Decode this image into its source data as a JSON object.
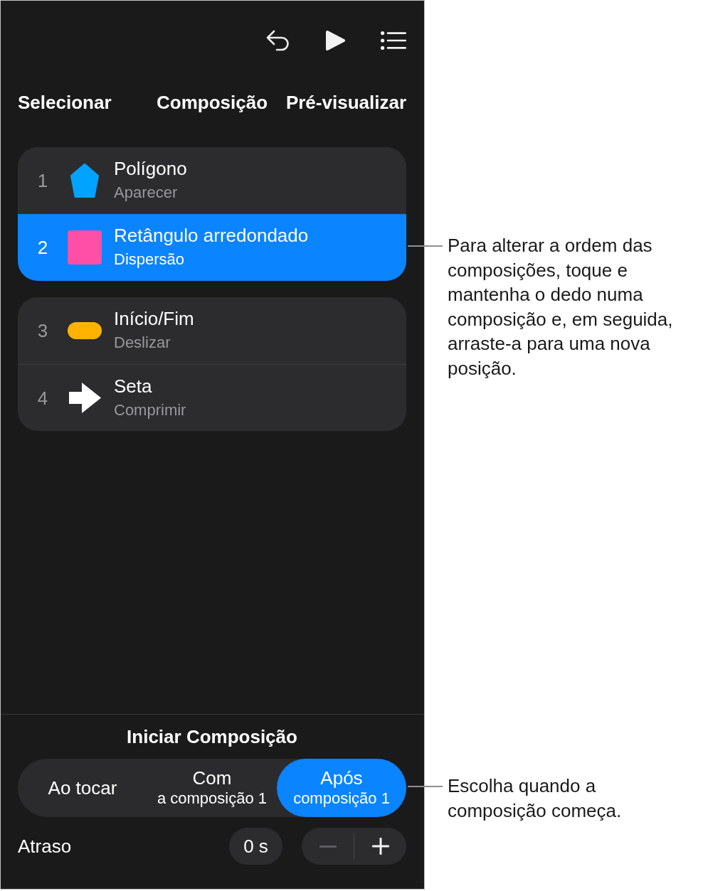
{
  "nav_bar": {
    "left_button": "Selecionar",
    "title": "Composição",
    "right_button": "Pré-visualizar"
  },
  "build_list": {
    "groups": [
      {
        "rows": [
          {
            "number": "1",
            "kind": "pentagon",
            "color": "#00a3ff",
            "title": "Polígono",
            "effect": "Aparecer",
            "selected": false
          },
          {
            "number": "2",
            "kind": "rounded_square",
            "color": "#ff4fa6",
            "title": "Retângulo arredondado",
            "effect": "Dispersão",
            "selected": true
          }
        ]
      },
      {
        "rows": [
          {
            "number": "3",
            "kind": "pill",
            "color": "#ffb300",
            "title": "Início/Fim",
            "effect": "Deslizar",
            "selected": false
          },
          {
            "number": "4",
            "kind": "arrow",
            "color": "#ffffff",
            "title": "Seta",
            "effect": "Comprimir",
            "selected": false
          }
        ]
      }
    ]
  },
  "start_build": {
    "title": "Iniciar Composição",
    "options": [
      {
        "label": "Ao tocar",
        "selected": false
      },
      {
        "label": "Com",
        "detail": "a composição 1",
        "selected": false
      },
      {
        "label": "Após",
        "detail": "composição 1",
        "selected": true
      }
    ]
  },
  "delay": {
    "label": "Atraso",
    "value": "0 s",
    "decrease_disabled": true,
    "increase_disabled": false
  },
  "callouts": [
    {
      "text": "Para alterar a ordem das composições, toque e mantenha o dedo numa composição e, em seguida, arraste-a para uma nova posição."
    },
    {
      "text": "Escolha quando a composição começa."
    }
  ]
}
